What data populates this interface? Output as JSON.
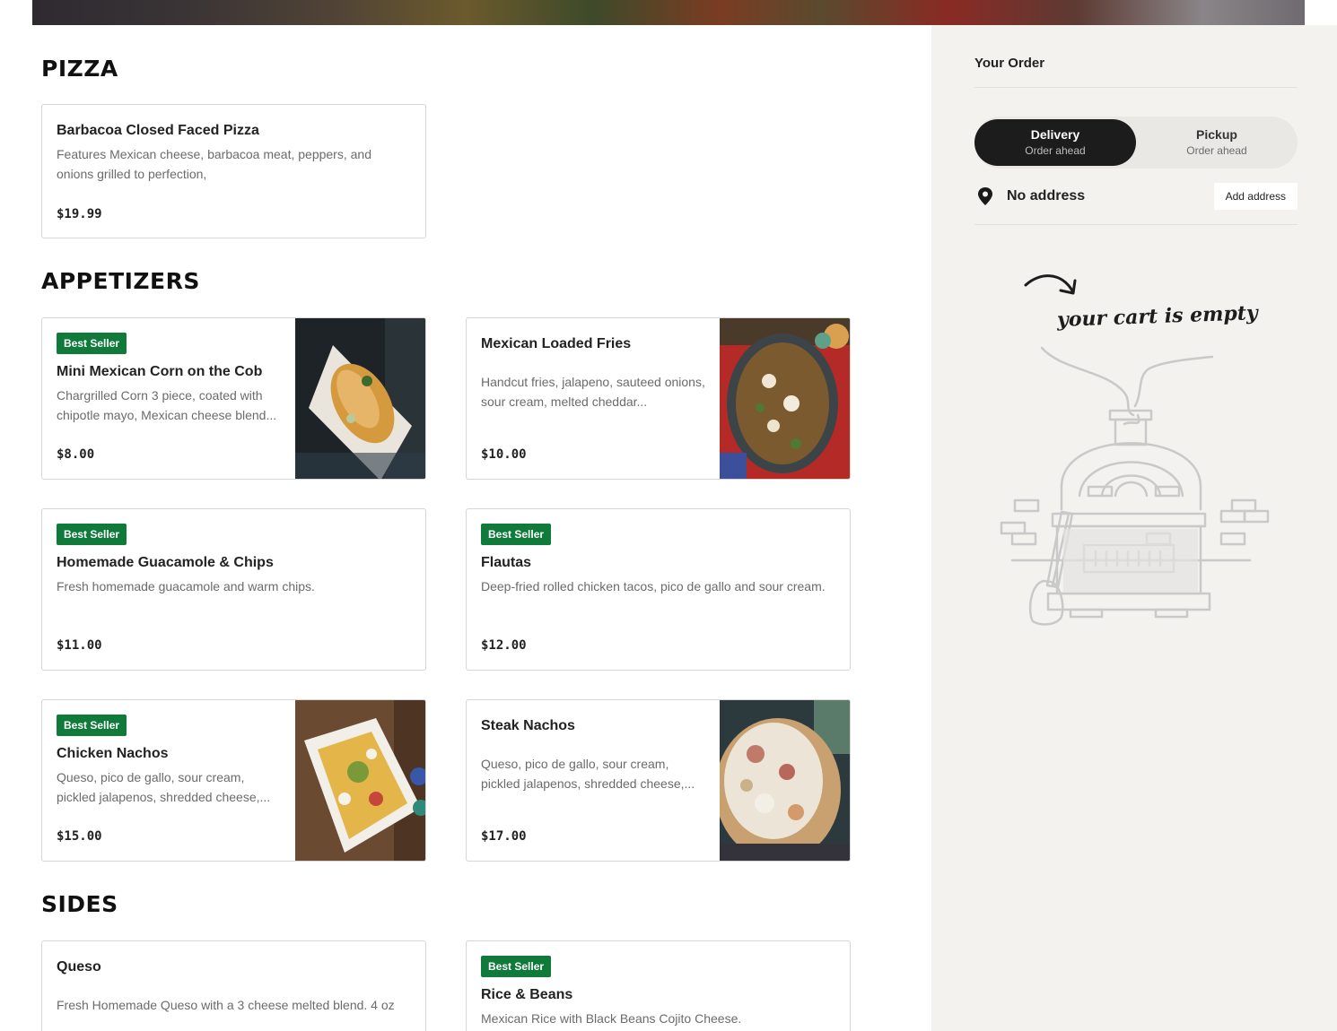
{
  "sections": [
    {
      "title": "PIZZA",
      "items": [
        {
          "name": "Barbacoa Closed Faced Pizza",
          "description": "Features Mexican cheese, barbacoa meat, peppers, and onions grilled to perfection,",
          "price": "$19.99",
          "badge": ""
        }
      ]
    },
    {
      "title": "APPETIZERS",
      "items": [
        {
          "name": "Mini Mexican Corn on the Cob",
          "description": "Chargrilled Corn 3 piece, coated with chipotle mayo, Mexican cheese blend...",
          "price": "$8.00",
          "badge": "Best Seller"
        },
        {
          "name": "Mexican Loaded Fries",
          "description": "Handcut fries, jalapeno, sauteed onions, sour cream, melted cheddar...",
          "price": "$10.00",
          "badge": ""
        },
        {
          "name": "Homemade Guacamole & Chips",
          "description": "Fresh homemade guacamole and warm chips.",
          "price": "$11.00",
          "badge": "Best Seller"
        },
        {
          "name": "Flautas",
          "description": "Deep-fried rolled chicken tacos, pico de gallo and sour cream.",
          "price": "$12.00",
          "badge": "Best Seller"
        },
        {
          "name": "Chicken Nachos",
          "description": "Queso, pico de gallo, sour cream, pickled jalapenos, shredded cheese,...",
          "price": "$15.00",
          "badge": "Best Seller"
        },
        {
          "name": "Steak Nachos",
          "description": "Queso, pico de gallo, sour cream, pickled jalapenos, shredded cheese,...",
          "price": "$17.00",
          "badge": ""
        }
      ]
    },
    {
      "title": "SIDES",
      "items": [
        {
          "name": "Queso",
          "description": "Fresh Homemade Queso with a 3 cheese melted blend. 4 oz",
          "price": "",
          "badge": ""
        },
        {
          "name": "Rice & Beans",
          "description": "Mexican Rice with Black Beans Cojito Cheese.",
          "price": "",
          "badge": "Best Seller"
        }
      ]
    }
  ],
  "order": {
    "title": "Your Order",
    "delivery": {
      "label": "Delivery",
      "sub": "Order ahead"
    },
    "pickup": {
      "label": "Pickup",
      "sub": "Order ahead"
    },
    "address": "No address",
    "add_address_label": "Add address",
    "empty_text": "your cart is empty"
  },
  "colors": {
    "badge": "#0f7a3a",
    "toggle_active": "#1c1c1c",
    "sidebar_bg": "#f3f2ef"
  },
  "icons": {
    "address": "location-pin-icon",
    "arrow": "curved-arrow-icon",
    "illustration": "pizza-oven-illustration"
  }
}
